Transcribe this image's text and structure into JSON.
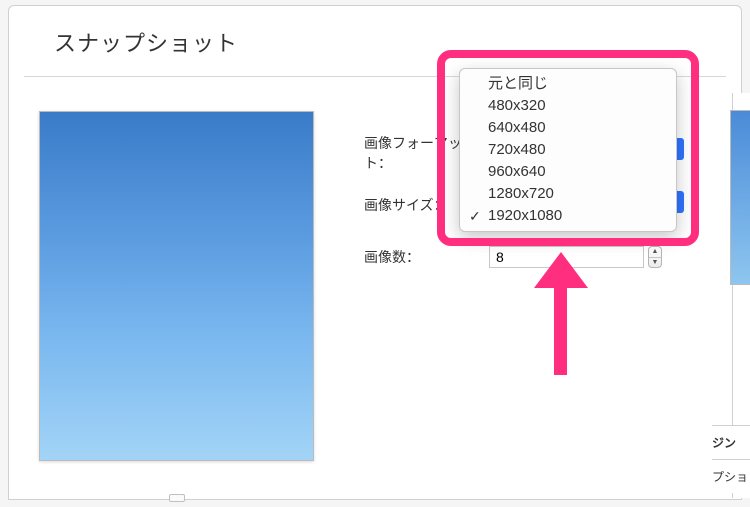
{
  "window": {
    "title": "スナップショット"
  },
  "form": {
    "format_label": "画像フォーマット：",
    "size_label": "画像サイズ：",
    "count_label": "画像数：",
    "count_value": "8"
  },
  "size_options": [
    {
      "label": "元と同じ",
      "selected": false
    },
    {
      "label": "480x320",
      "selected": false
    },
    {
      "label": "640x480",
      "selected": false
    },
    {
      "label": "720x480",
      "selected": false
    },
    {
      "label": "960x640",
      "selected": false
    },
    {
      "label": "1280x720",
      "selected": false
    },
    {
      "label": "1920x1080",
      "selected": true
    }
  ],
  "right_panel": {
    "line1": "ジン",
    "line2": "プショ"
  }
}
